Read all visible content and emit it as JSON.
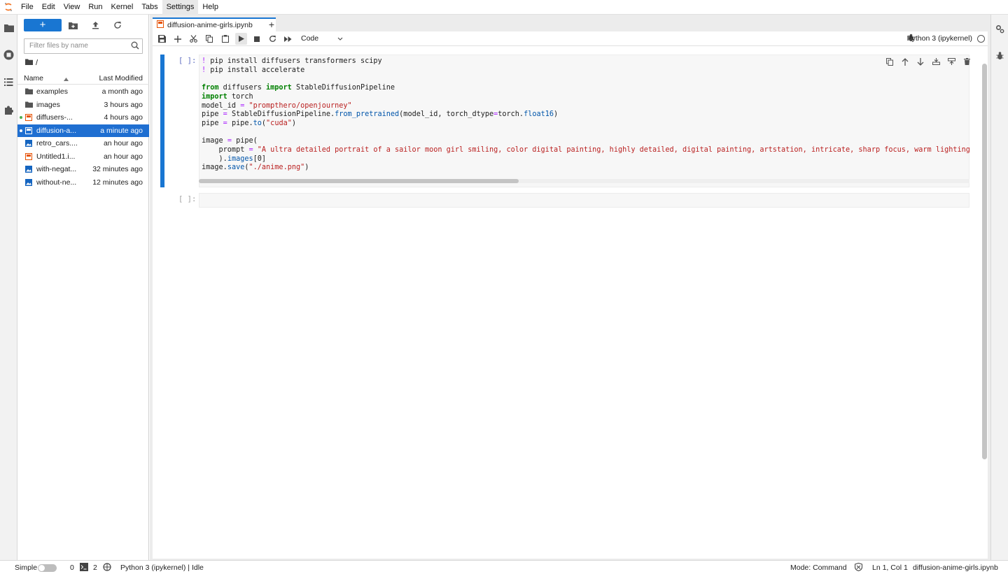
{
  "menubar": {
    "items": [
      "File",
      "Edit",
      "View",
      "Run",
      "Kernel",
      "Tabs",
      "Settings",
      "Help"
    ],
    "active": "Settings"
  },
  "filebrowser": {
    "new_label": "+",
    "filter_placeholder": "Filter files by name",
    "breadcrumb": "/",
    "col_name": "Name",
    "col_modified": "Last Modified",
    "files": [
      {
        "name": "examples",
        "modified": "a month ago",
        "type": "folder",
        "running": false,
        "selected": false
      },
      {
        "name": "images",
        "modified": "3 hours ago",
        "type": "folder",
        "running": false,
        "selected": false
      },
      {
        "name": "diffusers-...",
        "modified": "4 hours ago",
        "type": "notebook",
        "running": true,
        "selected": false
      },
      {
        "name": "diffusion-a...",
        "modified": "a minute ago",
        "type": "notebook",
        "running": true,
        "selected": true
      },
      {
        "name": "retro_cars....",
        "modified": "an hour ago",
        "type": "image",
        "running": false,
        "selected": false
      },
      {
        "name": "Untitled1.i...",
        "modified": "an hour ago",
        "type": "notebook",
        "running": false,
        "selected": false
      },
      {
        "name": "with-negat...",
        "modified": "32 minutes ago",
        "type": "image",
        "running": false,
        "selected": false
      },
      {
        "name": "without-ne...",
        "modified": "12 minutes ago",
        "type": "image",
        "running": false,
        "selected": false
      }
    ]
  },
  "tab": {
    "title": "diffusion-anime-girls.ipynb",
    "add_label": "+"
  },
  "toolbar": {
    "cell_type": "Code",
    "kernel": "Python 3 (ipykernel)"
  },
  "cells": [
    {
      "prompt": "[ ]:"
    },
    {
      "prompt": "[ ]:"
    }
  ],
  "code": {
    "l1_bang": "!",
    "l1_rest": " pip install diffusers transformers scipy",
    "l2_bang": "!",
    "l2_rest": " pip install accelerate",
    "l4_from": "from",
    "l4_mod": " diffusers ",
    "l4_import": "import",
    "l4_name": " StableDiffusionPipeline",
    "l5_import": "import",
    "l5_name": " torch",
    "l6_var": "model_id ",
    "l6_eq": "=",
    "l6_str": " \"prompthero/openjourney\"",
    "l7_a": "pipe ",
    "l7_eq": "=",
    "l7_b": " StableDiffusionPipeline.",
    "l7_fn": "from_pretrained",
    "l7_c": "(model_id, torch_dtype",
    "l7_eq2": "=",
    "l7_d": "torch.",
    "l7_fn2": "float16",
    "l7_e": ")",
    "l8_a": "pipe ",
    "l8_eq": "=",
    "l8_b": " pipe.",
    "l8_fn": "to",
    "l8_c": "(",
    "l8_str": "\"cuda\"",
    "l8_d": ")",
    "l10_a": "image ",
    "l10_eq": "=",
    "l10_b": " pipe(",
    "l11_a": "    prompt ",
    "l11_eq": "=",
    "l11_str": " \"A ultra detailed portrait of a sailor moon girl smiling, color digital painting, highly detailed, digital painting, artstation, intricate, sharp focus, warm lighting, attrac",
    "l12_a": "    ).",
    "l12_fn": "images",
    "l12_b": "[0]",
    "l13_a": "image.",
    "l13_fn": "save",
    "l13_b": "(",
    "l13_str": "\"./anime.png\"",
    "l13_c": ")"
  },
  "statusbar": {
    "simple": "Simple",
    "terminals": "0",
    "kernels": "2",
    "kernel_status": "Python 3 (ipykernel) | Idle",
    "mode": "Mode: Command",
    "position": "Ln 1, Col 1",
    "filename": "diffusion-anime-girls.ipynb"
  },
  "colors": {
    "accent": "#1976d2",
    "selected_row": "#1f6fd1",
    "notebook_icon": "#e65100",
    "running_dot": "#4caf50"
  }
}
